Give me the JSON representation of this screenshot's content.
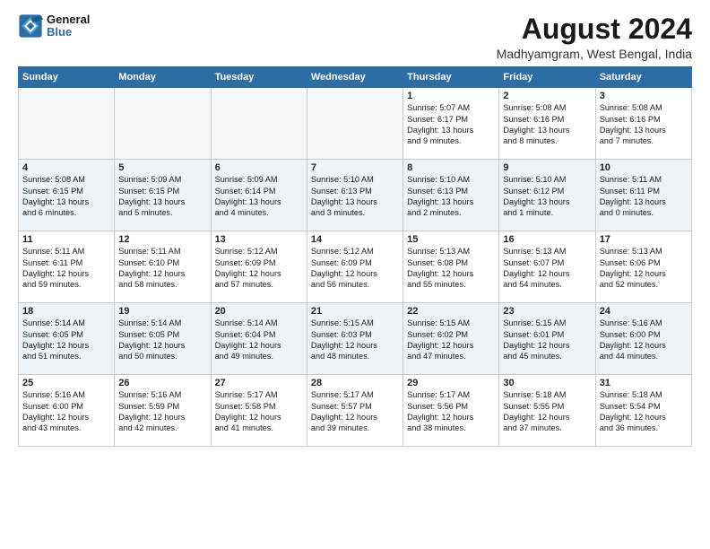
{
  "logo": {
    "line1": "General",
    "line2": "Blue"
  },
  "title": "August 2024",
  "subtitle": "Madhyamgram, West Bengal, India",
  "colors": {
    "header_bg": "#2e6da4"
  },
  "days_of_week": [
    "Sunday",
    "Monday",
    "Tuesday",
    "Wednesday",
    "Thursday",
    "Friday",
    "Saturday"
  ],
  "weeks": [
    [
      {
        "day": "",
        "info": ""
      },
      {
        "day": "",
        "info": ""
      },
      {
        "day": "",
        "info": ""
      },
      {
        "day": "",
        "info": ""
      },
      {
        "day": "1",
        "info": "Sunrise: 5:07 AM\nSunset: 6:17 PM\nDaylight: 13 hours\nand 9 minutes."
      },
      {
        "day": "2",
        "info": "Sunrise: 5:08 AM\nSunset: 6:16 PM\nDaylight: 13 hours\nand 8 minutes."
      },
      {
        "day": "3",
        "info": "Sunrise: 5:08 AM\nSunset: 6:16 PM\nDaylight: 13 hours\nand 7 minutes."
      }
    ],
    [
      {
        "day": "4",
        "info": "Sunrise: 5:08 AM\nSunset: 6:15 PM\nDaylight: 13 hours\nand 6 minutes."
      },
      {
        "day": "5",
        "info": "Sunrise: 5:09 AM\nSunset: 6:15 PM\nDaylight: 13 hours\nand 5 minutes."
      },
      {
        "day": "6",
        "info": "Sunrise: 5:09 AM\nSunset: 6:14 PM\nDaylight: 13 hours\nand 4 minutes."
      },
      {
        "day": "7",
        "info": "Sunrise: 5:10 AM\nSunset: 6:13 PM\nDaylight: 13 hours\nand 3 minutes."
      },
      {
        "day": "8",
        "info": "Sunrise: 5:10 AM\nSunset: 6:13 PM\nDaylight: 13 hours\nand 2 minutes."
      },
      {
        "day": "9",
        "info": "Sunrise: 5:10 AM\nSunset: 6:12 PM\nDaylight: 13 hours\nand 1 minute."
      },
      {
        "day": "10",
        "info": "Sunrise: 5:11 AM\nSunset: 6:11 PM\nDaylight: 13 hours\nand 0 minutes."
      }
    ],
    [
      {
        "day": "11",
        "info": "Sunrise: 5:11 AM\nSunset: 6:11 PM\nDaylight: 12 hours\nand 59 minutes."
      },
      {
        "day": "12",
        "info": "Sunrise: 5:11 AM\nSunset: 6:10 PM\nDaylight: 12 hours\nand 58 minutes."
      },
      {
        "day": "13",
        "info": "Sunrise: 5:12 AM\nSunset: 6:09 PM\nDaylight: 12 hours\nand 57 minutes."
      },
      {
        "day": "14",
        "info": "Sunrise: 5:12 AM\nSunset: 6:09 PM\nDaylight: 12 hours\nand 56 minutes."
      },
      {
        "day": "15",
        "info": "Sunrise: 5:13 AM\nSunset: 6:08 PM\nDaylight: 12 hours\nand 55 minutes."
      },
      {
        "day": "16",
        "info": "Sunrise: 5:13 AM\nSunset: 6:07 PM\nDaylight: 12 hours\nand 54 minutes."
      },
      {
        "day": "17",
        "info": "Sunrise: 5:13 AM\nSunset: 6:06 PM\nDaylight: 12 hours\nand 52 minutes."
      }
    ],
    [
      {
        "day": "18",
        "info": "Sunrise: 5:14 AM\nSunset: 6:05 PM\nDaylight: 12 hours\nand 51 minutes."
      },
      {
        "day": "19",
        "info": "Sunrise: 5:14 AM\nSunset: 6:05 PM\nDaylight: 12 hours\nand 50 minutes."
      },
      {
        "day": "20",
        "info": "Sunrise: 5:14 AM\nSunset: 6:04 PM\nDaylight: 12 hours\nand 49 minutes."
      },
      {
        "day": "21",
        "info": "Sunrise: 5:15 AM\nSunset: 6:03 PM\nDaylight: 12 hours\nand 48 minutes."
      },
      {
        "day": "22",
        "info": "Sunrise: 5:15 AM\nSunset: 6:02 PM\nDaylight: 12 hours\nand 47 minutes."
      },
      {
        "day": "23",
        "info": "Sunrise: 5:15 AM\nSunset: 6:01 PM\nDaylight: 12 hours\nand 45 minutes."
      },
      {
        "day": "24",
        "info": "Sunrise: 5:16 AM\nSunset: 6:00 PM\nDaylight: 12 hours\nand 44 minutes."
      }
    ],
    [
      {
        "day": "25",
        "info": "Sunrise: 5:16 AM\nSunset: 6:00 PM\nDaylight: 12 hours\nand 43 minutes."
      },
      {
        "day": "26",
        "info": "Sunrise: 5:16 AM\nSunset: 5:59 PM\nDaylight: 12 hours\nand 42 minutes."
      },
      {
        "day": "27",
        "info": "Sunrise: 5:17 AM\nSunset: 5:58 PM\nDaylight: 12 hours\nand 41 minutes."
      },
      {
        "day": "28",
        "info": "Sunrise: 5:17 AM\nSunset: 5:57 PM\nDaylight: 12 hours\nand 39 minutes."
      },
      {
        "day": "29",
        "info": "Sunrise: 5:17 AM\nSunset: 5:56 PM\nDaylight: 12 hours\nand 38 minutes."
      },
      {
        "day": "30",
        "info": "Sunrise: 5:18 AM\nSunset: 5:55 PM\nDaylight: 12 hours\nand 37 minutes."
      },
      {
        "day": "31",
        "info": "Sunrise: 5:18 AM\nSunset: 5:54 PM\nDaylight: 12 hours\nand 36 minutes."
      }
    ]
  ]
}
